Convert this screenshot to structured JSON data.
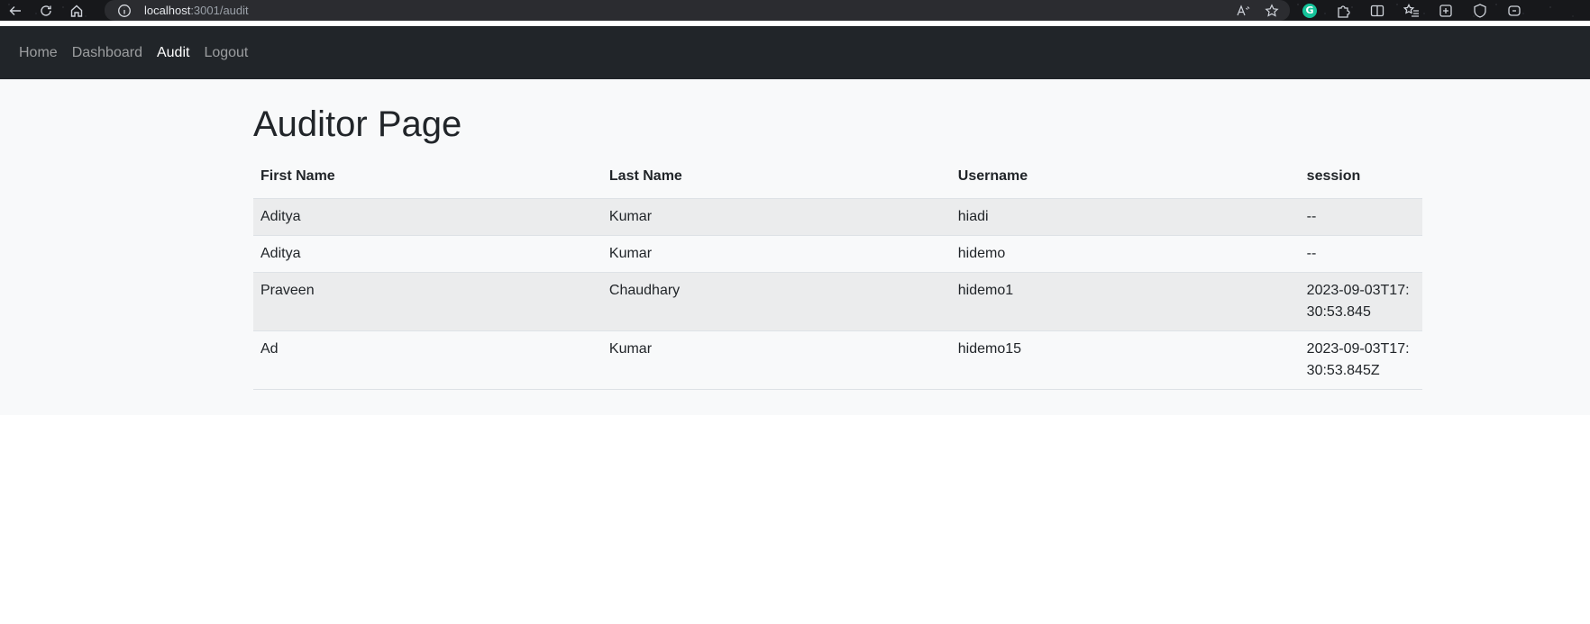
{
  "browser": {
    "url_host": "localhost",
    "url_rest": ":3001/audit"
  },
  "navbar": {
    "links": [
      {
        "label": "Home",
        "active": false
      },
      {
        "label": "Dashboard",
        "active": false
      },
      {
        "label": "Audit",
        "active": true
      },
      {
        "label": "Logout",
        "active": false
      }
    ]
  },
  "page": {
    "title": "Auditor Page"
  },
  "table": {
    "headers": [
      "First Name",
      "Last Name",
      "Username",
      "session"
    ],
    "rows": [
      [
        "Aditya",
        "Kumar",
        "hiadi",
        "--"
      ],
      [
        "Aditya",
        "Kumar",
        "hidemo",
        "--"
      ],
      [
        "Praveen",
        "Chaudhary",
        "hidemo1",
        "2023-09-03T17:30:53.845"
      ],
      [
        "Ad",
        "Kumar",
        "hidemo15",
        "2023-09-03T17:30:53.845Z"
      ]
    ]
  },
  "colors": {
    "navbar_bg": "#212529",
    "content_bg": "#f8f9fa",
    "striped_row": "#ebeced"
  }
}
